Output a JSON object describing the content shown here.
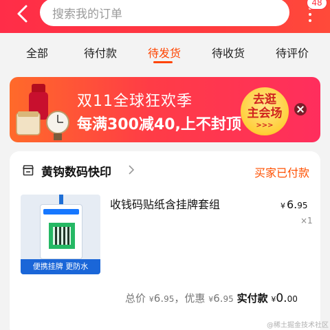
{
  "header": {
    "search_placeholder": "搜索我的订单",
    "badge_count": "48"
  },
  "tabs": [
    {
      "label": "全部"
    },
    {
      "label": "待付款"
    },
    {
      "label": "待发货",
      "active": true
    },
    {
      "label": "待收货"
    },
    {
      "label": "待评价"
    }
  ],
  "banner": {
    "title": "双11全球狂欢季",
    "subtitle": "每满300减40,上不封顶",
    "cta_line1": "去逛",
    "cta_line2": "主会场",
    "cta_arrows": ">>>"
  },
  "order": {
    "shop_name": "黄钩数码快印",
    "status": "买家已付款",
    "item": {
      "title": "收钱码贴纸含挂牌套组",
      "thumb_label": "便携挂牌 更防水",
      "price_currency": "¥",
      "price_int": "6.",
      "price_cents": "95",
      "qty": "×1"
    },
    "summary": {
      "total_label": "总价",
      "currency": "¥",
      "total_int": "6.",
      "total_cents": "95",
      "discount_label": "，优惠",
      "discount_int": "6.",
      "discount_cents": "95",
      "paid_label": "实付款",
      "paid_int": "0.",
      "paid_cents": "00"
    }
  },
  "watermark": "@稀土掘金技术社区",
  "colors": {
    "header": "#ff2d48",
    "accent": "#ff4400",
    "status": "#ff5000"
  }
}
